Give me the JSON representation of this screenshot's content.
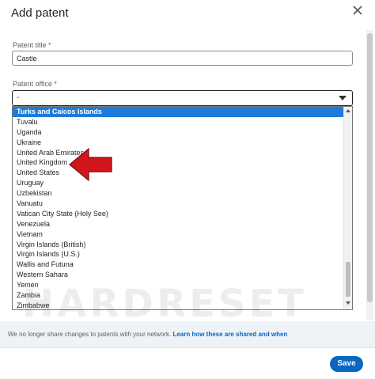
{
  "dialog": {
    "title": "Add patent"
  },
  "fields": {
    "patent_title_label": "Patent title",
    "patent_title_required": "*",
    "patent_title_value": "Castle",
    "patent_office_label": "Patent office",
    "patent_office_required": "*",
    "patent_office_value": "-"
  },
  "dropdown": {
    "selected": "Turks and Caicos Islands",
    "options": [
      "Turks and Caicos Islands",
      "Tuvalu",
      "Uganda",
      "Ukraine",
      "United Arab Emirates",
      "United Kingdom",
      "United States",
      "Uruguay",
      "Uzbekistan",
      "Vanuatu",
      "Vatican City State (Holy See)",
      "Venezuela",
      "Vietnam",
      "Virgin Islands (British)",
      "Virgin Islands (U.S.)",
      "Wallis and Futuna",
      "Western Sahara",
      "Yemen",
      "Zambia",
      "Zimbabwe"
    ]
  },
  "info": {
    "text": "We no longer share changes to patents with your network.",
    "link": "Learn how these are shared and when"
  },
  "footer": {
    "save_label": "Save"
  },
  "watermark": {
    "main": "HARDRESET",
    "sub": ".INFO"
  },
  "colors": {
    "accent": "#0a66c2",
    "selected_option": "#1e7cd8",
    "arrow": "#d0161c",
    "info_bg": "#eef3f8"
  },
  "icons": {
    "close": "close-icon",
    "annotation": "red-arrow-annotation"
  }
}
